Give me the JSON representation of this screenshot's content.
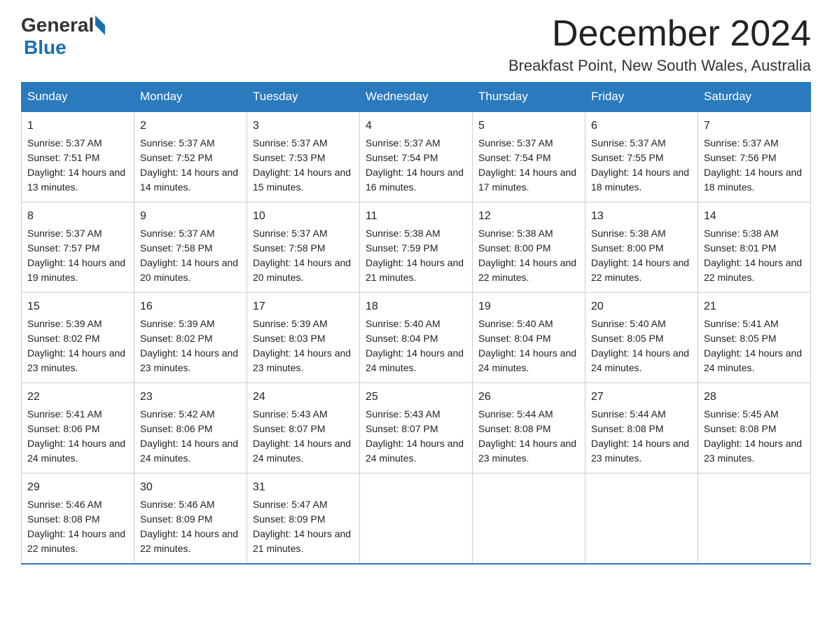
{
  "header": {
    "logo": {
      "general": "General",
      "blue": "Blue"
    },
    "month_year": "December 2024",
    "location": "Breakfast Point, New South Wales, Australia"
  },
  "days_of_week": [
    "Sunday",
    "Monday",
    "Tuesday",
    "Wednesday",
    "Thursday",
    "Friday",
    "Saturday"
  ],
  "weeks": [
    [
      {
        "day": "1",
        "sunrise": "Sunrise: 5:37 AM",
        "sunset": "Sunset: 7:51 PM",
        "daylight": "Daylight: 14 hours and 13 minutes."
      },
      {
        "day": "2",
        "sunrise": "Sunrise: 5:37 AM",
        "sunset": "Sunset: 7:52 PM",
        "daylight": "Daylight: 14 hours and 14 minutes."
      },
      {
        "day": "3",
        "sunrise": "Sunrise: 5:37 AM",
        "sunset": "Sunset: 7:53 PM",
        "daylight": "Daylight: 14 hours and 15 minutes."
      },
      {
        "day": "4",
        "sunrise": "Sunrise: 5:37 AM",
        "sunset": "Sunset: 7:54 PM",
        "daylight": "Daylight: 14 hours and 16 minutes."
      },
      {
        "day": "5",
        "sunrise": "Sunrise: 5:37 AM",
        "sunset": "Sunset: 7:54 PM",
        "daylight": "Daylight: 14 hours and 17 minutes."
      },
      {
        "day": "6",
        "sunrise": "Sunrise: 5:37 AM",
        "sunset": "Sunset: 7:55 PM",
        "daylight": "Daylight: 14 hours and 18 minutes."
      },
      {
        "day": "7",
        "sunrise": "Sunrise: 5:37 AM",
        "sunset": "Sunset: 7:56 PM",
        "daylight": "Daylight: 14 hours and 18 minutes."
      }
    ],
    [
      {
        "day": "8",
        "sunrise": "Sunrise: 5:37 AM",
        "sunset": "Sunset: 7:57 PM",
        "daylight": "Daylight: 14 hours and 19 minutes."
      },
      {
        "day": "9",
        "sunrise": "Sunrise: 5:37 AM",
        "sunset": "Sunset: 7:58 PM",
        "daylight": "Daylight: 14 hours and 20 minutes."
      },
      {
        "day": "10",
        "sunrise": "Sunrise: 5:37 AM",
        "sunset": "Sunset: 7:58 PM",
        "daylight": "Daylight: 14 hours and 20 minutes."
      },
      {
        "day": "11",
        "sunrise": "Sunrise: 5:38 AM",
        "sunset": "Sunset: 7:59 PM",
        "daylight": "Daylight: 14 hours and 21 minutes."
      },
      {
        "day": "12",
        "sunrise": "Sunrise: 5:38 AM",
        "sunset": "Sunset: 8:00 PM",
        "daylight": "Daylight: 14 hours and 22 minutes."
      },
      {
        "day": "13",
        "sunrise": "Sunrise: 5:38 AM",
        "sunset": "Sunset: 8:00 PM",
        "daylight": "Daylight: 14 hours and 22 minutes."
      },
      {
        "day": "14",
        "sunrise": "Sunrise: 5:38 AM",
        "sunset": "Sunset: 8:01 PM",
        "daylight": "Daylight: 14 hours and 22 minutes."
      }
    ],
    [
      {
        "day": "15",
        "sunrise": "Sunrise: 5:39 AM",
        "sunset": "Sunset: 8:02 PM",
        "daylight": "Daylight: 14 hours and 23 minutes."
      },
      {
        "day": "16",
        "sunrise": "Sunrise: 5:39 AM",
        "sunset": "Sunset: 8:02 PM",
        "daylight": "Daylight: 14 hours and 23 minutes."
      },
      {
        "day": "17",
        "sunrise": "Sunrise: 5:39 AM",
        "sunset": "Sunset: 8:03 PM",
        "daylight": "Daylight: 14 hours and 23 minutes."
      },
      {
        "day": "18",
        "sunrise": "Sunrise: 5:40 AM",
        "sunset": "Sunset: 8:04 PM",
        "daylight": "Daylight: 14 hours and 24 minutes."
      },
      {
        "day": "19",
        "sunrise": "Sunrise: 5:40 AM",
        "sunset": "Sunset: 8:04 PM",
        "daylight": "Daylight: 14 hours and 24 minutes."
      },
      {
        "day": "20",
        "sunrise": "Sunrise: 5:40 AM",
        "sunset": "Sunset: 8:05 PM",
        "daylight": "Daylight: 14 hours and 24 minutes."
      },
      {
        "day": "21",
        "sunrise": "Sunrise: 5:41 AM",
        "sunset": "Sunset: 8:05 PM",
        "daylight": "Daylight: 14 hours and 24 minutes."
      }
    ],
    [
      {
        "day": "22",
        "sunrise": "Sunrise: 5:41 AM",
        "sunset": "Sunset: 8:06 PM",
        "daylight": "Daylight: 14 hours and 24 minutes."
      },
      {
        "day": "23",
        "sunrise": "Sunrise: 5:42 AM",
        "sunset": "Sunset: 8:06 PM",
        "daylight": "Daylight: 14 hours and 24 minutes."
      },
      {
        "day": "24",
        "sunrise": "Sunrise: 5:43 AM",
        "sunset": "Sunset: 8:07 PM",
        "daylight": "Daylight: 14 hours and 24 minutes."
      },
      {
        "day": "25",
        "sunrise": "Sunrise: 5:43 AM",
        "sunset": "Sunset: 8:07 PM",
        "daylight": "Daylight: 14 hours and 24 minutes."
      },
      {
        "day": "26",
        "sunrise": "Sunrise: 5:44 AM",
        "sunset": "Sunset: 8:08 PM",
        "daylight": "Daylight: 14 hours and 23 minutes."
      },
      {
        "day": "27",
        "sunrise": "Sunrise: 5:44 AM",
        "sunset": "Sunset: 8:08 PM",
        "daylight": "Daylight: 14 hours and 23 minutes."
      },
      {
        "day": "28",
        "sunrise": "Sunrise: 5:45 AM",
        "sunset": "Sunset: 8:08 PM",
        "daylight": "Daylight: 14 hours and 23 minutes."
      }
    ],
    [
      {
        "day": "29",
        "sunrise": "Sunrise: 5:46 AM",
        "sunset": "Sunset: 8:08 PM",
        "daylight": "Daylight: 14 hours and 22 minutes."
      },
      {
        "day": "30",
        "sunrise": "Sunrise: 5:46 AM",
        "sunset": "Sunset: 8:09 PM",
        "daylight": "Daylight: 14 hours and 22 minutes."
      },
      {
        "day": "31",
        "sunrise": "Sunrise: 5:47 AM",
        "sunset": "Sunset: 8:09 PM",
        "daylight": "Daylight: 14 hours and 21 minutes."
      },
      null,
      null,
      null,
      null
    ]
  ]
}
